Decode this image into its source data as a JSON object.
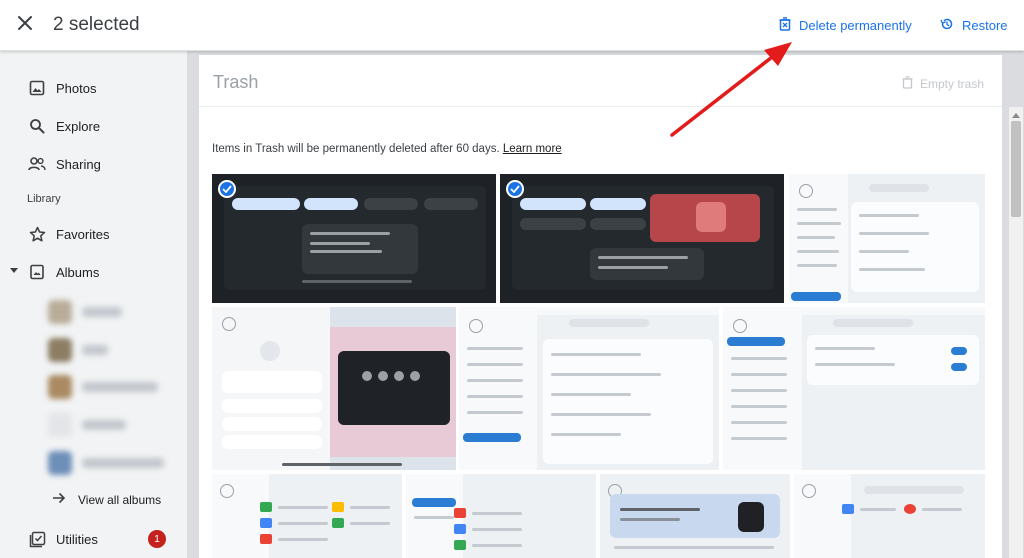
{
  "header": {
    "selected_count": "2 selected",
    "delete_label": "Delete permanently",
    "restore_label": "Restore"
  },
  "sidebar": {
    "items": [
      {
        "label": "Photos",
        "icon": "photo-icon"
      },
      {
        "label": "Explore",
        "icon": "search-icon"
      },
      {
        "label": "Sharing",
        "icon": "people-icon"
      }
    ],
    "library_label": "Library",
    "favorites_label": "Favorites",
    "albums_label": "Albums",
    "view_all_label": "View all albums",
    "utilities_label": "Utilities",
    "utilities_badge": "1"
  },
  "main": {
    "title": "Trash",
    "empty_trash_label": "Empty trash",
    "info_text": "Items in Trash will be permanently deleted after 60 days.",
    "learn_more": "Learn more",
    "selected_thumbs": 2,
    "thumbnail_count": 10
  },
  "colors": {
    "accent": "#1a73e8",
    "annotation_arrow": "#e31b1b",
    "badge": "#c5221f"
  }
}
